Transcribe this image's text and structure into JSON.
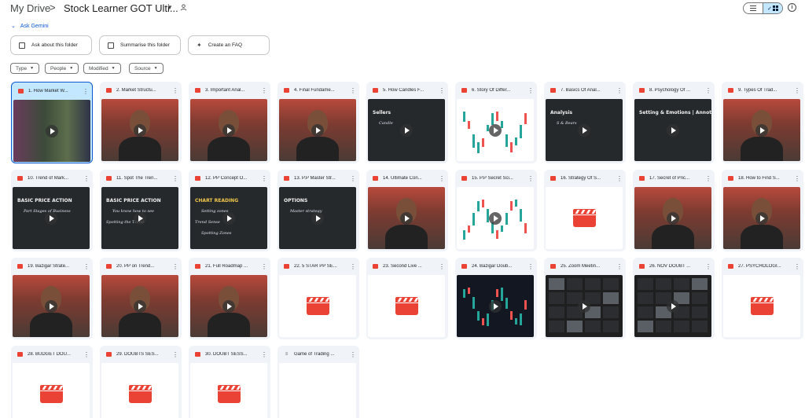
{
  "breadcrumb": {
    "root": "My Drive",
    "separator": ">",
    "current": "Stock Learner GOT Ulti..."
  },
  "view": {
    "list_icon": "list-icon",
    "grid_icon": "grid-icon",
    "check": "✓"
  },
  "gemini": {
    "label": "Ask Gemini"
  },
  "actions": [
    {
      "label": "Ask about this folder",
      "icon": "folder-question-icon"
    },
    {
      "label": "Summarise this folder",
      "icon": "summarise-icon"
    },
    {
      "label": "Create an FAQ",
      "icon": "faq-icon"
    }
  ],
  "filters": [
    "Type",
    "People",
    "Modified",
    "Source"
  ],
  "files": [
    {
      "title": "1. How Market W...",
      "kind": "collage",
      "selected": true
    },
    {
      "title": "2. Market Structu...",
      "kind": "person"
    },
    {
      "title": "3. Important Anal...",
      "kind": "person"
    },
    {
      "title": "4. Final Fundame...",
      "kind": "person"
    },
    {
      "title": "5. How Candles F...",
      "kind": "board",
      "board_lines": [
        "Sellers",
        "Candle"
      ]
    },
    {
      "title": "6. Story Of Differ...",
      "kind": "chart-light"
    },
    {
      "title": "7. Basics Of Anal...",
      "kind": "board",
      "board_lines": [
        "Analysis",
        "S & Bears"
      ]
    },
    {
      "title": "8. Psychology Of ...",
      "kind": "board",
      "board_lines": [
        "Setting & Emotions | Annotations"
      ]
    },
    {
      "title": "9. Types Of Trad...",
      "kind": "person"
    },
    {
      "title": "10. Trend of Mark...",
      "kind": "board",
      "board_lines": [
        "BASIC PRICE ACTION",
        "Part Stages of Business"
      ]
    },
    {
      "title": "11. Spot The Tren...",
      "kind": "board",
      "board_lines": [
        "BASIC PRICE ACTION",
        "You know how to see",
        "Spotting the Trend"
      ]
    },
    {
      "title": "12. PP Concept O...",
      "kind": "board",
      "board_lines": [
        "CHART READING",
        "Setting zones",
        "Trend Sense",
        "Spotting Zones"
      ]
    },
    {
      "title": "13. P.P Master Str...",
      "kind": "board",
      "board_lines": [
        "OPTIONS",
        "Master strategy"
      ]
    },
    {
      "title": "14. Ultimate Con...",
      "kind": "person"
    },
    {
      "title": "15. P.P Secret Sci...",
      "kind": "chart-light"
    },
    {
      "title": "16. Strategy Of S...",
      "kind": "clap"
    },
    {
      "title": "17. Secret of Pric...",
      "kind": "person"
    },
    {
      "title": "18. How to Find S...",
      "kind": "person"
    },
    {
      "title": "19. Bazigar Strate...",
      "kind": "person"
    },
    {
      "title": "20. PP on Trend...",
      "kind": "person"
    },
    {
      "title": "21. Full Roadmap ...",
      "kind": "person"
    },
    {
      "title": "22. 5 STAR PP SE...",
      "kind": "clap"
    },
    {
      "title": "23. Second Live ...",
      "kind": "clap"
    },
    {
      "title": "24. Bazigar Doub...",
      "kind": "chart-dark"
    },
    {
      "title": "25. Zoom Meetin...",
      "kind": "zoom"
    },
    {
      "title": "26. NOV DOUBT ...",
      "kind": "zoom"
    },
    {
      "title": "27. PSYCHOLOGI...",
      "kind": "clap"
    },
    {
      "title": "28. BUDGET DOU...",
      "kind": "clap"
    },
    {
      "title": "29. DOUBTS SES...",
      "kind": "clap"
    },
    {
      "title": "30. DOUBT SESS...",
      "kind": "clap"
    },
    {
      "title": "Game of Trading ...",
      "kind": "doc"
    }
  ]
}
